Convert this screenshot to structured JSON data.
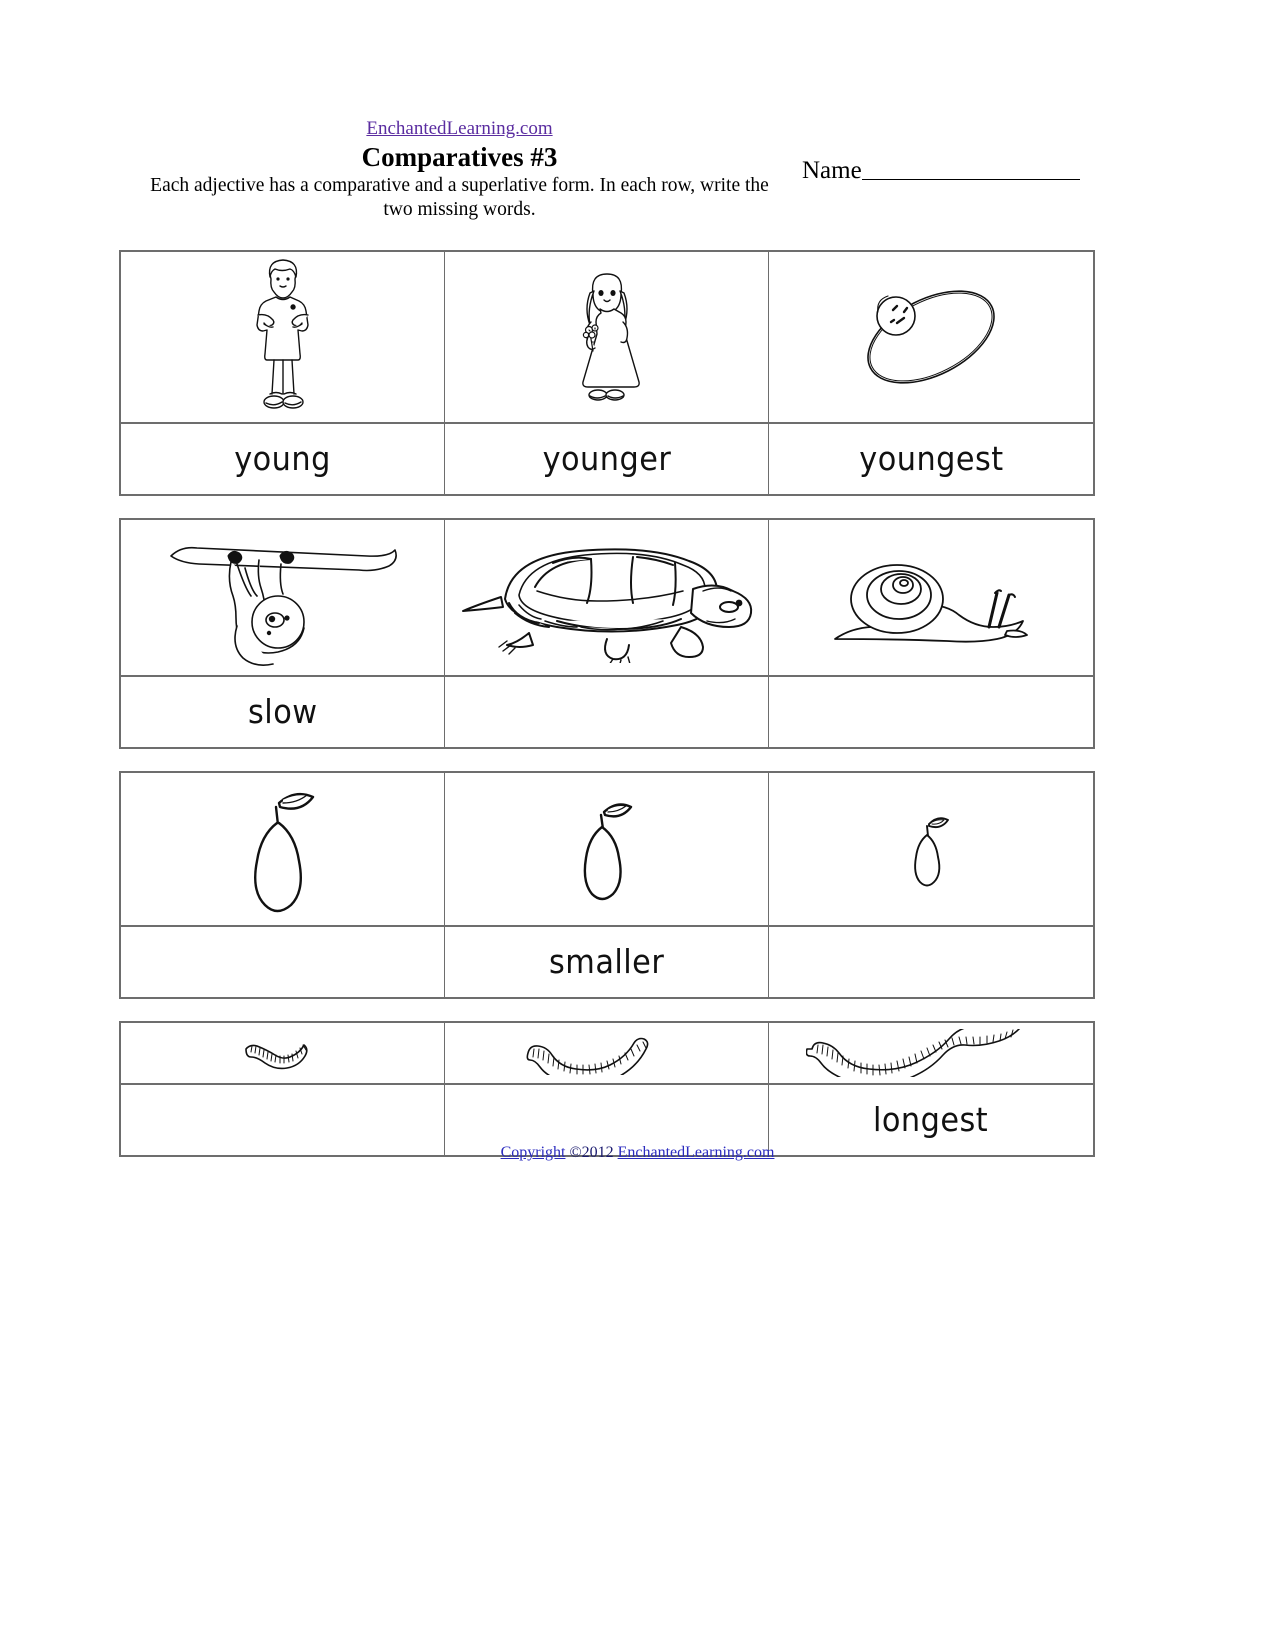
{
  "header": {
    "site_link": "EnchantedLearning.com",
    "title": "Comparatives #3",
    "instructions": "Each adjective has a comparative and a superlative form. In each row, write the two missing words.",
    "name_label": "Name"
  },
  "rows": [
    {
      "id": "young",
      "images": [
        "woman-standing",
        "girl-with-flowers",
        "baby-in-blanket"
      ],
      "words": [
        "young",
        "younger",
        "youngest"
      ]
    },
    {
      "id": "slow",
      "images": [
        "sloth-hanging-branch",
        "turtle",
        "snail"
      ],
      "words": [
        "slow",
        "",
        ""
      ]
    },
    {
      "id": "small",
      "images": [
        "large-pear",
        "medium-pear",
        "small-pear"
      ],
      "words": [
        "",
        "smaller",
        ""
      ]
    },
    {
      "id": "long",
      "images": [
        "short-worm",
        "medium-worm",
        "long-worm"
      ],
      "words": [
        "",
        "",
        "longest"
      ]
    }
  ],
  "footer": {
    "copyright_word": "Copyright",
    "copyright_mid": " ©2012 ",
    "copyright_site": "EnchantedLearning.com"
  },
  "colors": {
    "link_purple": "#5a2ca0",
    "link_blue": "#2b2bbf",
    "border_gray": "#6d6d6d",
    "ink": "#000000"
  }
}
